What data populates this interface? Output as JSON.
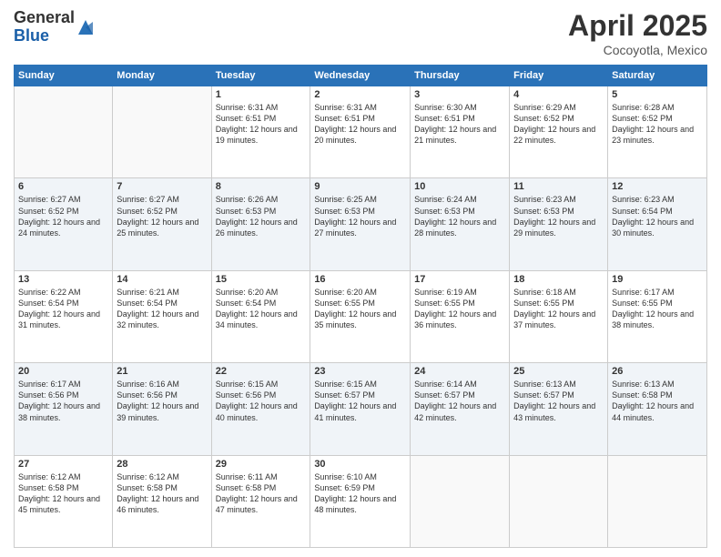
{
  "header": {
    "logo_general": "General",
    "logo_blue": "Blue",
    "month_title": "April 2025",
    "location": "Cocoyotla, Mexico"
  },
  "days_of_week": [
    "Sunday",
    "Monday",
    "Tuesday",
    "Wednesday",
    "Thursday",
    "Friday",
    "Saturday"
  ],
  "weeks": [
    [
      {
        "day": "",
        "info": ""
      },
      {
        "day": "",
        "info": ""
      },
      {
        "day": "1",
        "info": "Sunrise: 6:31 AM\nSunset: 6:51 PM\nDaylight: 12 hours and 19 minutes."
      },
      {
        "day": "2",
        "info": "Sunrise: 6:31 AM\nSunset: 6:51 PM\nDaylight: 12 hours and 20 minutes."
      },
      {
        "day": "3",
        "info": "Sunrise: 6:30 AM\nSunset: 6:51 PM\nDaylight: 12 hours and 21 minutes."
      },
      {
        "day": "4",
        "info": "Sunrise: 6:29 AM\nSunset: 6:52 PM\nDaylight: 12 hours and 22 minutes."
      },
      {
        "day": "5",
        "info": "Sunrise: 6:28 AM\nSunset: 6:52 PM\nDaylight: 12 hours and 23 minutes."
      }
    ],
    [
      {
        "day": "6",
        "info": "Sunrise: 6:27 AM\nSunset: 6:52 PM\nDaylight: 12 hours and 24 minutes."
      },
      {
        "day": "7",
        "info": "Sunrise: 6:27 AM\nSunset: 6:52 PM\nDaylight: 12 hours and 25 minutes."
      },
      {
        "day": "8",
        "info": "Sunrise: 6:26 AM\nSunset: 6:53 PM\nDaylight: 12 hours and 26 minutes."
      },
      {
        "day": "9",
        "info": "Sunrise: 6:25 AM\nSunset: 6:53 PM\nDaylight: 12 hours and 27 minutes."
      },
      {
        "day": "10",
        "info": "Sunrise: 6:24 AM\nSunset: 6:53 PM\nDaylight: 12 hours and 28 minutes."
      },
      {
        "day": "11",
        "info": "Sunrise: 6:23 AM\nSunset: 6:53 PM\nDaylight: 12 hours and 29 minutes."
      },
      {
        "day": "12",
        "info": "Sunrise: 6:23 AM\nSunset: 6:54 PM\nDaylight: 12 hours and 30 minutes."
      }
    ],
    [
      {
        "day": "13",
        "info": "Sunrise: 6:22 AM\nSunset: 6:54 PM\nDaylight: 12 hours and 31 minutes."
      },
      {
        "day": "14",
        "info": "Sunrise: 6:21 AM\nSunset: 6:54 PM\nDaylight: 12 hours and 32 minutes."
      },
      {
        "day": "15",
        "info": "Sunrise: 6:20 AM\nSunset: 6:54 PM\nDaylight: 12 hours and 34 minutes."
      },
      {
        "day": "16",
        "info": "Sunrise: 6:20 AM\nSunset: 6:55 PM\nDaylight: 12 hours and 35 minutes."
      },
      {
        "day": "17",
        "info": "Sunrise: 6:19 AM\nSunset: 6:55 PM\nDaylight: 12 hours and 36 minutes."
      },
      {
        "day": "18",
        "info": "Sunrise: 6:18 AM\nSunset: 6:55 PM\nDaylight: 12 hours and 37 minutes."
      },
      {
        "day": "19",
        "info": "Sunrise: 6:17 AM\nSunset: 6:55 PM\nDaylight: 12 hours and 38 minutes."
      }
    ],
    [
      {
        "day": "20",
        "info": "Sunrise: 6:17 AM\nSunset: 6:56 PM\nDaylight: 12 hours and 38 minutes."
      },
      {
        "day": "21",
        "info": "Sunrise: 6:16 AM\nSunset: 6:56 PM\nDaylight: 12 hours and 39 minutes."
      },
      {
        "day": "22",
        "info": "Sunrise: 6:15 AM\nSunset: 6:56 PM\nDaylight: 12 hours and 40 minutes."
      },
      {
        "day": "23",
        "info": "Sunrise: 6:15 AM\nSunset: 6:57 PM\nDaylight: 12 hours and 41 minutes."
      },
      {
        "day": "24",
        "info": "Sunrise: 6:14 AM\nSunset: 6:57 PM\nDaylight: 12 hours and 42 minutes."
      },
      {
        "day": "25",
        "info": "Sunrise: 6:13 AM\nSunset: 6:57 PM\nDaylight: 12 hours and 43 minutes."
      },
      {
        "day": "26",
        "info": "Sunrise: 6:13 AM\nSunset: 6:58 PM\nDaylight: 12 hours and 44 minutes."
      }
    ],
    [
      {
        "day": "27",
        "info": "Sunrise: 6:12 AM\nSunset: 6:58 PM\nDaylight: 12 hours and 45 minutes."
      },
      {
        "day": "28",
        "info": "Sunrise: 6:12 AM\nSunset: 6:58 PM\nDaylight: 12 hours and 46 minutes."
      },
      {
        "day": "29",
        "info": "Sunrise: 6:11 AM\nSunset: 6:58 PM\nDaylight: 12 hours and 47 minutes."
      },
      {
        "day": "30",
        "info": "Sunrise: 6:10 AM\nSunset: 6:59 PM\nDaylight: 12 hours and 48 minutes."
      },
      {
        "day": "",
        "info": ""
      },
      {
        "day": "",
        "info": ""
      },
      {
        "day": "",
        "info": ""
      }
    ]
  ]
}
